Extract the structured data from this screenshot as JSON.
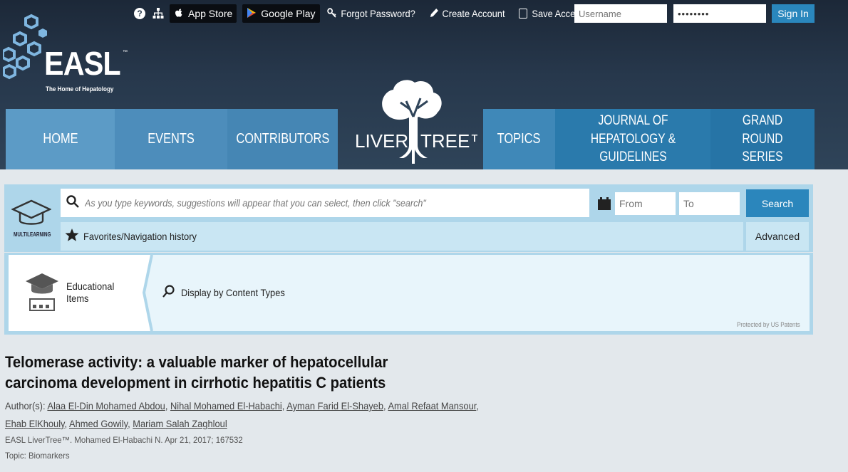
{
  "topbar": {
    "app_store": "App Store",
    "google_play": "Google Play",
    "forgot_password": "Forgot Password?",
    "create_account": "Create Account",
    "save_access": "Save Access",
    "username_placeholder": "Username",
    "password_value": "••••••••",
    "sign_in": "Sign In"
  },
  "logo": {
    "word": "EASL",
    "tm": "™",
    "tagline": "The Home of Hepatology"
  },
  "nav": {
    "home": "HOME",
    "events": "EVENTS",
    "contributors": "CONTRIBUTORS",
    "liver": "LIVER",
    "tree": "TREE™",
    "topics": "TOPICS",
    "journal": "JOURNAL OF HEPATOLOGY & GUIDELINES",
    "grand_round": "GRAND ROUND SERIES"
  },
  "search": {
    "multilearning": "MULTILEARNING",
    "placeholder": "As you type keywords, suggestions will appear that you can select, then click \"search\"",
    "from_placeholder": "From",
    "to_placeholder": "To",
    "search_button": "Search",
    "favorites": "Favorites/Navigation history",
    "advanced": "Advanced"
  },
  "content_types": {
    "educational_items": "Educational Items",
    "display_by": "Display by Content Types",
    "patents": "Protected by US Patents"
  },
  "article": {
    "title": "Telomerase activity: a valuable marker of hepatocellular carcinoma development in cirrhotic hepatitis C patients",
    "authors_label": "Author(s):",
    "authors": [
      "Alaa El-Din Mohamed Abdou",
      "Nihal Mohamed El-Habachi",
      "Ayman Farid El-Shayeb",
      "Amal Refaat Mansour",
      "Ehab ElKhouly",
      "Ahmed Gowily",
      "Mariam Salah Zaghloul"
    ],
    "meta": "EASL LiverTree™. Mohamed El-Habachi N. Apr 21, 2017; 167532",
    "topic": "Topic: Biomarkers"
  },
  "colors": {
    "header_dark": "#27384c",
    "nav_blue": "#4586b4",
    "accent": "#2b86bc",
    "panel": "#aed6ea"
  }
}
